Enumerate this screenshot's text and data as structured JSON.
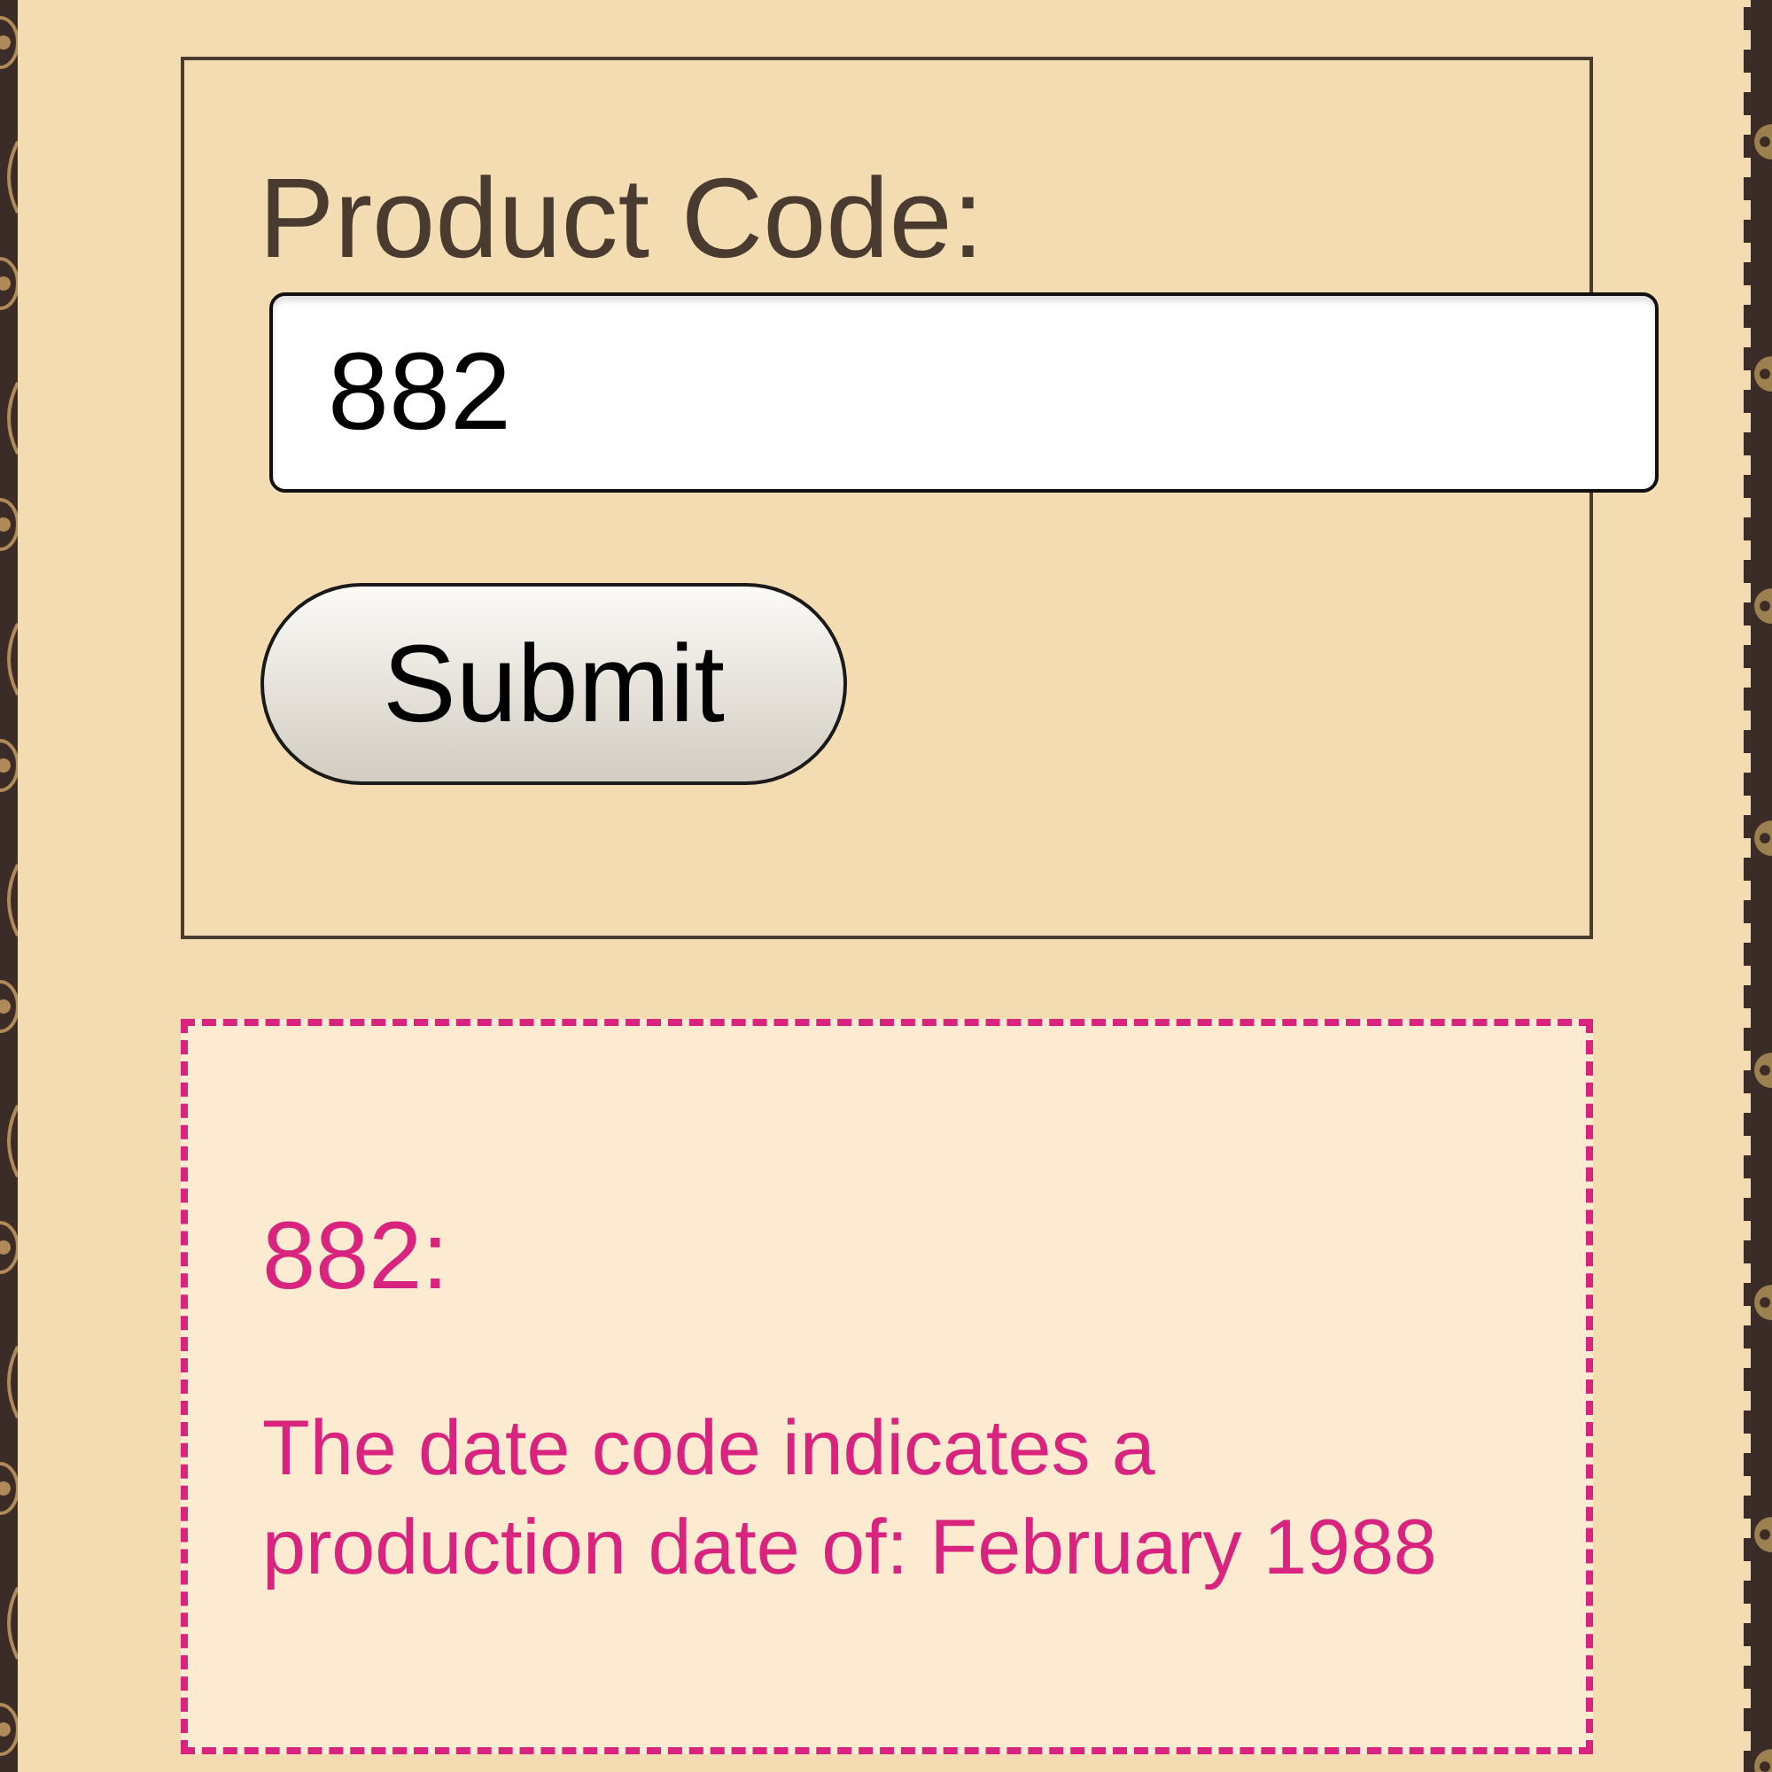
{
  "form": {
    "label": "Product Code:",
    "input": {
      "value": "882"
    },
    "submit_button": "Submit"
  },
  "result": {
    "heading": "882:",
    "message": "The date code indicates a production date of: February 1988"
  }
}
